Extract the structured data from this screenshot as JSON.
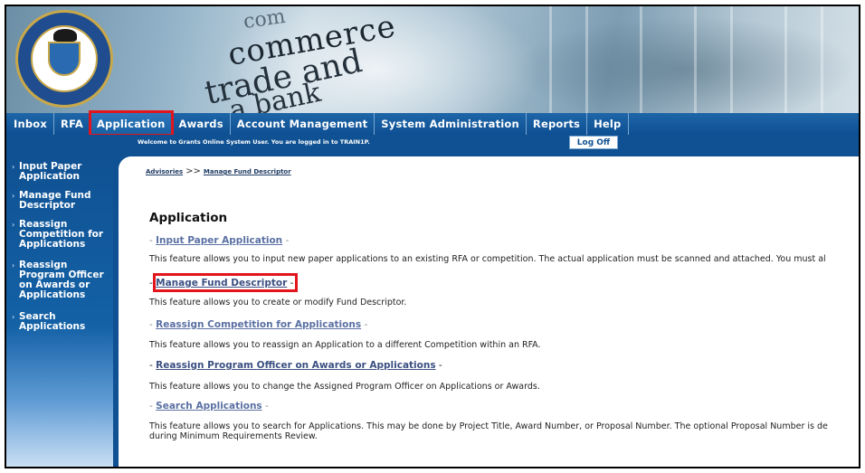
{
  "banner": {
    "words": [
      "com",
      "commerce",
      "trade and",
      "a bank"
    ],
    "seal": {
      "top_text": "DEPARTMENT OF COMMERCE",
      "bottom_text": "UNITED STATES OF AMERICA"
    }
  },
  "nav": {
    "tabs": [
      {
        "label": "Inbox",
        "active": false
      },
      {
        "label": "RFA",
        "active": false
      },
      {
        "label": "Application",
        "active": true
      },
      {
        "label": "Awards",
        "active": false
      },
      {
        "label": "Account Management",
        "active": false
      },
      {
        "label": "System Administration",
        "active": false
      },
      {
        "label": "Reports",
        "active": false
      },
      {
        "label": "Help",
        "active": false
      }
    ]
  },
  "welcome": {
    "message": "Welcome to Grants Online System User. You are logged in to TRAIN1P.",
    "logoff_label": "Log Off"
  },
  "sidebar": {
    "items": [
      {
        "label": "Input Paper Application"
      },
      {
        "label": "Manage Fund Descriptor"
      },
      {
        "label": "Reassign Competition for Applications"
      },
      {
        "label": "Reassign Program Officer on Awards or Applications"
      },
      {
        "label": "Search Applications"
      }
    ]
  },
  "breadcrumb": {
    "root": "Advisories",
    "separator": ">>",
    "current": "Manage Fund Descriptor"
  },
  "main": {
    "title": "Application",
    "sections": [
      {
        "link": "Input Paper Application",
        "description": "This feature allows you to input new paper applications to an existing RFA or competition. The actual application must be scanned and attached. You must al"
      },
      {
        "link": "Manage Fund Descriptor",
        "description": "This feature allows you to create or modify Fund Descriptor."
      },
      {
        "link": "Reassign Competition for Applications",
        "description": "This feature allows you to reassign an Application to a different Competition within an RFA."
      },
      {
        "link": "Reassign Program Officer on Awards or Applications",
        "description": "This feature allows you to change the Assigned Program Officer on Applications or Awards."
      },
      {
        "link": "Search Applications",
        "description": "This feature allows you to search for Applications. This may be done by Project Title, Award Number, or Proposal Number. The optional Proposal Number is de",
        "description_line2": "during Minimum Requirements Review."
      }
    ]
  },
  "colors": {
    "nav_blue": "#0f5192",
    "highlight_red": "#e2141c",
    "link": "#5a70a3"
  }
}
